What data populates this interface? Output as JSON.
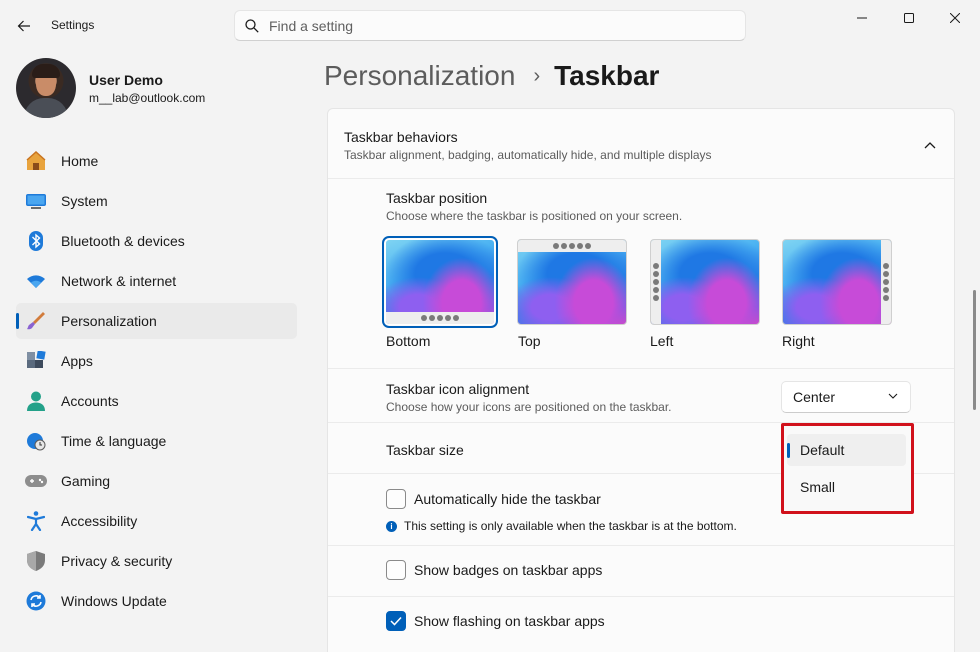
{
  "titlebar": {
    "app_title": "Settings",
    "search_placeholder": "Find a setting"
  },
  "profile": {
    "name": "User Demo",
    "email": "m__lab@outlook.com"
  },
  "sidebar": {
    "items": [
      {
        "label": "Home",
        "icon": "home-icon",
        "active": false
      },
      {
        "label": "System",
        "icon": "monitor-icon",
        "active": false
      },
      {
        "label": "Bluetooth & devices",
        "icon": "bluetooth-icon",
        "active": false
      },
      {
        "label": "Network & internet",
        "icon": "wifi-icon",
        "active": false
      },
      {
        "label": "Personalization",
        "icon": "brush-icon",
        "active": true
      },
      {
        "label": "Apps",
        "icon": "apps-icon",
        "active": false
      },
      {
        "label": "Accounts",
        "icon": "person-icon",
        "active": false
      },
      {
        "label": "Time & language",
        "icon": "clock-globe-icon",
        "active": false
      },
      {
        "label": "Gaming",
        "icon": "gamepad-icon",
        "active": false
      },
      {
        "label": "Accessibility",
        "icon": "accessibility-icon",
        "active": false
      },
      {
        "label": "Privacy & security",
        "icon": "shield-icon",
        "active": false
      },
      {
        "label": "Windows Update",
        "icon": "update-icon",
        "active": false
      }
    ]
  },
  "breadcrumb": {
    "parent": "Personalization",
    "separator": "›",
    "current": "Taskbar"
  },
  "behaviors": {
    "title": "Taskbar behaviors",
    "description": "Taskbar alignment, badging, automatically hide, and multiple displays",
    "position": {
      "title": "Taskbar position",
      "description": "Choose where the taskbar is positioned on your screen.",
      "options": [
        "Bottom",
        "Top",
        "Left",
        "Right"
      ],
      "selected": "Bottom"
    },
    "alignment": {
      "title": "Taskbar icon alignment",
      "description": "Choose how your icons are positioned on the taskbar.",
      "value": "Center"
    },
    "size": {
      "title": "Taskbar size",
      "options": [
        "Default",
        "Small"
      ],
      "selected": "Default"
    },
    "autohide": {
      "label": "Automatically hide the taskbar",
      "checked": false,
      "note": "This setting is only available when the taskbar is at the bottom."
    },
    "badges": {
      "label": "Show badges on taskbar apps",
      "checked": false
    },
    "flashing": {
      "label": "Show flashing on taskbar apps",
      "checked": true
    }
  },
  "colors": {
    "accent": "#005fb8",
    "highlight_border": "#d1111b"
  }
}
